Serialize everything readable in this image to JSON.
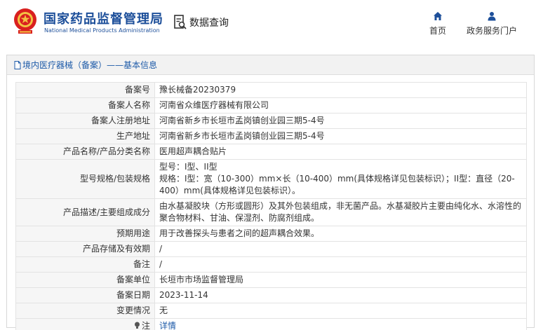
{
  "header": {
    "brand_cn": "国家药品监督管理局",
    "brand_en": "National Medical Products Administration",
    "search_label": "数据查询",
    "nav": [
      {
        "label": "首页",
        "icon": "home-icon"
      },
      {
        "label": "政务服务门户",
        "icon": "user-icon"
      }
    ],
    "colors": {
      "brand": "#1d4f9a",
      "link": "#1d5aa8",
      "emblem": "#d9201f"
    }
  },
  "section": {
    "title": "境内医疗器械（备案）——基本信息"
  },
  "rows": [
    {
      "label": "备案号",
      "value": "豫长械备20230379"
    },
    {
      "label": "备案人名称",
      "value": "河南省众维医疗器械有限公司"
    },
    {
      "label": "备案人注册地址",
      "value": "河南省新乡市长垣市孟岗镇创业园三期5-4号"
    },
    {
      "label": "生产地址",
      "value": "河南省新乡市长垣市孟岗镇创业园三期5-4号"
    },
    {
      "label": "产品名称/产品分类名称",
      "value": "医用超声耦合贴片"
    },
    {
      "label": "型号规格/包装规格",
      "value_lines": [
        "型号：I型、II型",
        "规格：I型：宽（10-300）mm×长（10-400）mm(具体规格详见包装标识）；II型：直径（20-400）mm(具体规格详见包装标识）。"
      ]
    },
    {
      "label": "产品描述/主要组成成分",
      "value": "由水基凝胶块（方形或圆形）及其外包装组成，非无菌产品。水基凝胶片主要由纯化水、水溶性的聚合物材料、甘油、保湿剂、防腐剂组成。"
    },
    {
      "label": "预期用途",
      "value": "用于改善探头与患者之间的超声耦合效果。"
    },
    {
      "label": "产品存储及有效期",
      "value": "/"
    },
    {
      "label": "备注",
      "value": "/"
    },
    {
      "label": "备案单位",
      "value": "长垣市市场监督管理局"
    },
    {
      "label": "备案日期",
      "value": "2023-11-14"
    },
    {
      "label": "变更情况",
      "value": "无"
    },
    {
      "label": "注",
      "value": "详情",
      "icon": "note-icon"
    }
  ]
}
